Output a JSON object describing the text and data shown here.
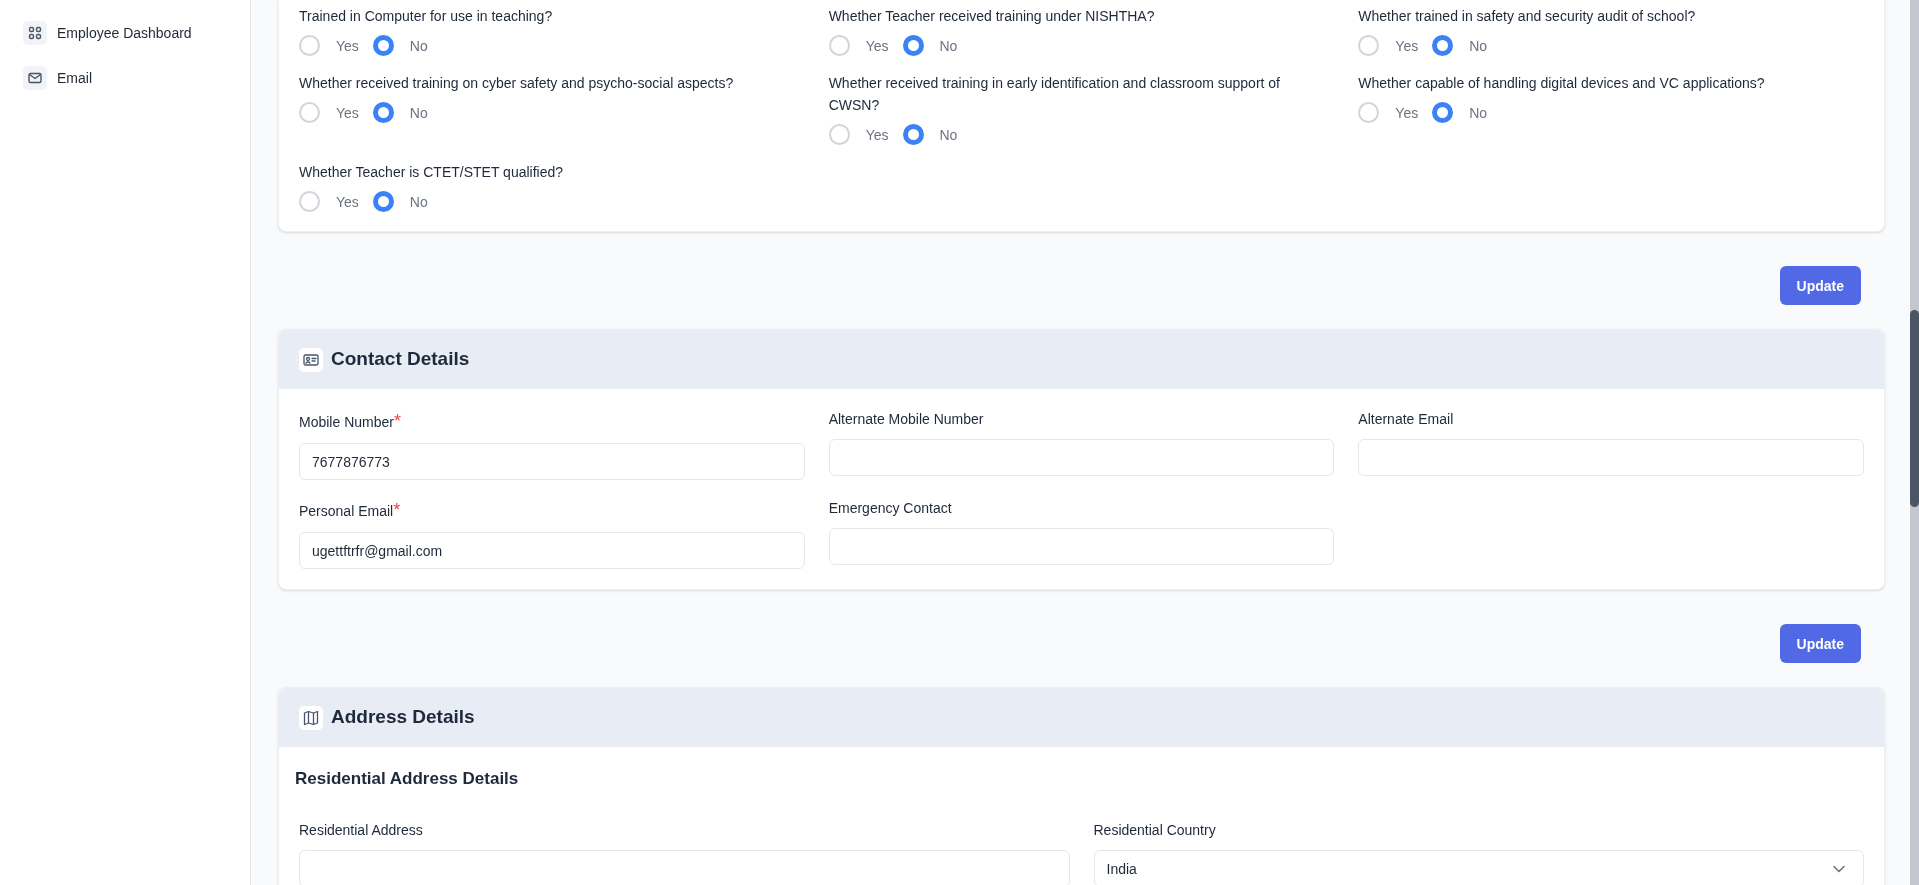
{
  "sidebar": {
    "items": [
      {
        "label": "Employee Dashboard"
      },
      {
        "label": "Email"
      }
    ]
  },
  "training_questions": {
    "questions": [
      {
        "label": "Trained in Computer for use in teaching?",
        "options": [
          {
            "label": "Yes",
            "selected": false
          },
          {
            "label": "No",
            "selected": true
          }
        ]
      },
      {
        "label": "Whether Teacher received training under NISHTHA?",
        "options": [
          {
            "label": "Yes",
            "selected": false
          },
          {
            "label": "No",
            "selected": true
          }
        ]
      },
      {
        "label": "Whether trained in safety and security audit of school?",
        "options": [
          {
            "label": "Yes",
            "selected": false
          },
          {
            "label": "No",
            "selected": true
          }
        ]
      },
      {
        "label": "Whether received training on cyber safety and psycho-social aspects?",
        "options": [
          {
            "label": "Yes",
            "selected": false
          },
          {
            "label": "No",
            "selected": true
          }
        ]
      },
      {
        "label": "Whether received training in early identification and classroom support of CWSN?",
        "options": [
          {
            "label": "Yes",
            "selected": false
          },
          {
            "label": "No",
            "selected": true
          }
        ]
      },
      {
        "label": "Whether capable of handling digital devices and VC applications?",
        "options": [
          {
            "label": "Yes",
            "selected": false
          },
          {
            "label": "No",
            "selected": true
          }
        ]
      },
      {
        "label": "Whether Teacher is CTET/STET qualified?",
        "options": [
          {
            "label": "Yes",
            "selected": false
          },
          {
            "label": "No",
            "selected": true
          }
        ]
      }
    ],
    "update_button": "Update"
  },
  "contact_details": {
    "title": "Contact Details",
    "fields": [
      {
        "label": "Mobile Number",
        "required_mark": "*",
        "value": "7677876773"
      },
      {
        "label": "Alternate Mobile Number"
      },
      {
        "label": "Alternate Email"
      },
      {
        "label": "Personal Email",
        "required_mark": "*",
        "value": "ugettftrfr@gmail.com"
      },
      {
        "label": "Emergency Contact"
      }
    ],
    "update_button": "Update"
  },
  "address_details": {
    "title": "Address Details",
    "subheading": "Residential Address Details",
    "fields": [
      {
        "label": "Residential Address",
        "kind": "text"
      },
      {
        "label": "Residential Country",
        "kind": "select",
        "value": "India"
      }
    ]
  }
}
